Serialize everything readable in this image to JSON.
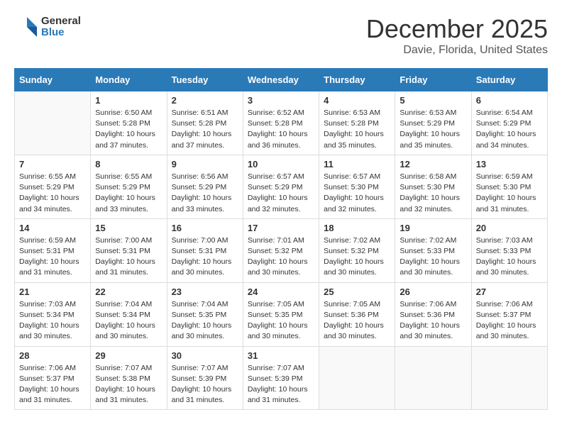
{
  "header": {
    "logo_line1": "General",
    "logo_line2": "Blue",
    "main_title": "December 2025",
    "subtitle": "Davie, Florida, United States"
  },
  "days_of_week": [
    "Sunday",
    "Monday",
    "Tuesday",
    "Wednesday",
    "Thursday",
    "Friday",
    "Saturday"
  ],
  "weeks": [
    [
      {
        "day": "",
        "info": ""
      },
      {
        "day": "1",
        "info": "Sunrise: 6:50 AM\nSunset: 5:28 PM\nDaylight: 10 hours\nand 37 minutes."
      },
      {
        "day": "2",
        "info": "Sunrise: 6:51 AM\nSunset: 5:28 PM\nDaylight: 10 hours\nand 37 minutes."
      },
      {
        "day": "3",
        "info": "Sunrise: 6:52 AM\nSunset: 5:28 PM\nDaylight: 10 hours\nand 36 minutes."
      },
      {
        "day": "4",
        "info": "Sunrise: 6:53 AM\nSunset: 5:28 PM\nDaylight: 10 hours\nand 35 minutes."
      },
      {
        "day": "5",
        "info": "Sunrise: 6:53 AM\nSunset: 5:29 PM\nDaylight: 10 hours\nand 35 minutes."
      },
      {
        "day": "6",
        "info": "Sunrise: 6:54 AM\nSunset: 5:29 PM\nDaylight: 10 hours\nand 34 minutes."
      }
    ],
    [
      {
        "day": "7",
        "info": "Sunrise: 6:55 AM\nSunset: 5:29 PM\nDaylight: 10 hours\nand 34 minutes."
      },
      {
        "day": "8",
        "info": "Sunrise: 6:55 AM\nSunset: 5:29 PM\nDaylight: 10 hours\nand 33 minutes."
      },
      {
        "day": "9",
        "info": "Sunrise: 6:56 AM\nSunset: 5:29 PM\nDaylight: 10 hours\nand 33 minutes."
      },
      {
        "day": "10",
        "info": "Sunrise: 6:57 AM\nSunset: 5:29 PM\nDaylight: 10 hours\nand 32 minutes."
      },
      {
        "day": "11",
        "info": "Sunrise: 6:57 AM\nSunset: 5:30 PM\nDaylight: 10 hours\nand 32 minutes."
      },
      {
        "day": "12",
        "info": "Sunrise: 6:58 AM\nSunset: 5:30 PM\nDaylight: 10 hours\nand 32 minutes."
      },
      {
        "day": "13",
        "info": "Sunrise: 6:59 AM\nSunset: 5:30 PM\nDaylight: 10 hours\nand 31 minutes."
      }
    ],
    [
      {
        "day": "14",
        "info": "Sunrise: 6:59 AM\nSunset: 5:31 PM\nDaylight: 10 hours\nand 31 minutes."
      },
      {
        "day": "15",
        "info": "Sunrise: 7:00 AM\nSunset: 5:31 PM\nDaylight: 10 hours\nand 31 minutes."
      },
      {
        "day": "16",
        "info": "Sunrise: 7:00 AM\nSunset: 5:31 PM\nDaylight: 10 hours\nand 30 minutes."
      },
      {
        "day": "17",
        "info": "Sunrise: 7:01 AM\nSunset: 5:32 PM\nDaylight: 10 hours\nand 30 minutes."
      },
      {
        "day": "18",
        "info": "Sunrise: 7:02 AM\nSunset: 5:32 PM\nDaylight: 10 hours\nand 30 minutes."
      },
      {
        "day": "19",
        "info": "Sunrise: 7:02 AM\nSunset: 5:33 PM\nDaylight: 10 hours\nand 30 minutes."
      },
      {
        "day": "20",
        "info": "Sunrise: 7:03 AM\nSunset: 5:33 PM\nDaylight: 10 hours\nand 30 minutes."
      }
    ],
    [
      {
        "day": "21",
        "info": "Sunrise: 7:03 AM\nSunset: 5:34 PM\nDaylight: 10 hours\nand 30 minutes."
      },
      {
        "day": "22",
        "info": "Sunrise: 7:04 AM\nSunset: 5:34 PM\nDaylight: 10 hours\nand 30 minutes."
      },
      {
        "day": "23",
        "info": "Sunrise: 7:04 AM\nSunset: 5:35 PM\nDaylight: 10 hours\nand 30 minutes."
      },
      {
        "day": "24",
        "info": "Sunrise: 7:05 AM\nSunset: 5:35 PM\nDaylight: 10 hours\nand 30 minutes."
      },
      {
        "day": "25",
        "info": "Sunrise: 7:05 AM\nSunset: 5:36 PM\nDaylight: 10 hours\nand 30 minutes."
      },
      {
        "day": "26",
        "info": "Sunrise: 7:06 AM\nSunset: 5:36 PM\nDaylight: 10 hours\nand 30 minutes."
      },
      {
        "day": "27",
        "info": "Sunrise: 7:06 AM\nSunset: 5:37 PM\nDaylight: 10 hours\nand 30 minutes."
      }
    ],
    [
      {
        "day": "28",
        "info": "Sunrise: 7:06 AM\nSunset: 5:37 PM\nDaylight: 10 hours\nand 31 minutes."
      },
      {
        "day": "29",
        "info": "Sunrise: 7:07 AM\nSunset: 5:38 PM\nDaylight: 10 hours\nand 31 minutes."
      },
      {
        "day": "30",
        "info": "Sunrise: 7:07 AM\nSunset: 5:39 PM\nDaylight: 10 hours\nand 31 minutes."
      },
      {
        "day": "31",
        "info": "Sunrise: 7:07 AM\nSunset: 5:39 PM\nDaylight: 10 hours\nand 31 minutes."
      },
      {
        "day": "",
        "info": ""
      },
      {
        "day": "",
        "info": ""
      },
      {
        "day": "",
        "info": ""
      }
    ]
  ]
}
